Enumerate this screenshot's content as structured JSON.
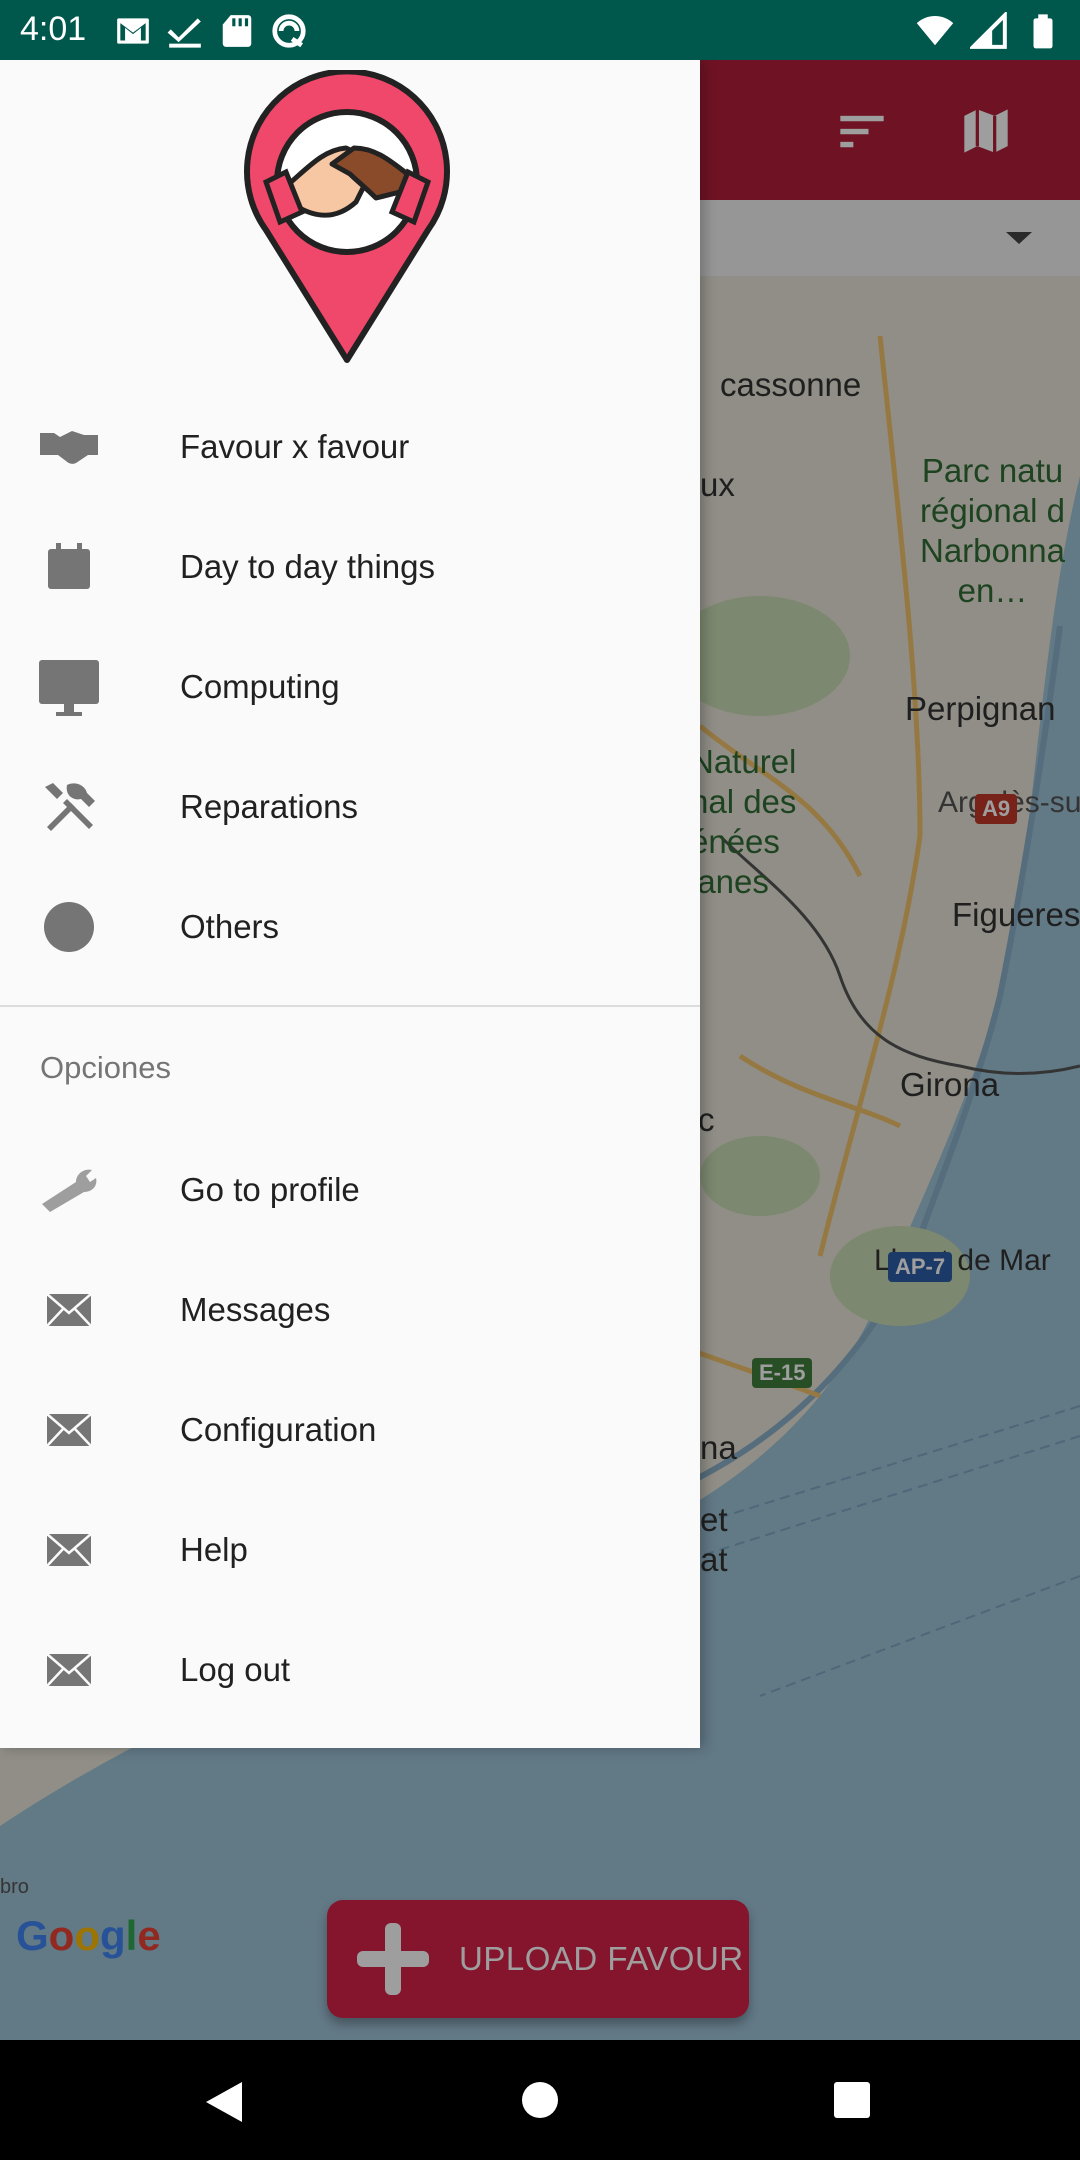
{
  "status_bar": {
    "time": "4:01",
    "left_icons": [
      "gmail-icon",
      "check-icon",
      "sd-card-icon",
      "sync-icon"
    ],
    "right_icons": [
      "wifi-icon",
      "signal-icon",
      "battery-icon"
    ]
  },
  "app_bar": {
    "color": "#B3203A",
    "icons": [
      "sort-icon",
      "map-icon"
    ]
  },
  "map": {
    "labels": [
      "cassonne",
      "ux",
      "Parc natu\nrégional d\nNarbonna\nen…",
      "Perpignan",
      "Naturel\nnal des\nénées\nlanes",
      "Argelès-su",
      "Figueres",
      "Girona",
      "c",
      "Lloret de Mar",
      "na",
      "et\nat",
      "bro"
    ],
    "road_badges": [
      "A9",
      "AP-7",
      "E-15"
    ]
  },
  "google_logo": "Google",
  "fab": {
    "label": "UPLOAD FAVOUR",
    "color": "#D6224A"
  },
  "drawer": {
    "categories": [
      {
        "label": "Favour x favour",
        "icon": "handshake-icon"
      },
      {
        "label": "Day to day things",
        "icon": "calendar-icon"
      },
      {
        "label": "Computing",
        "icon": "monitor-icon"
      },
      {
        "label": "Reparations",
        "icon": "tools-icon"
      },
      {
        "label": "Others",
        "icon": "circle-icon"
      }
    ],
    "section_title": "Opciones",
    "options": [
      {
        "label": "Go to profile",
        "icon": "wrench-icon"
      },
      {
        "label": "Messages",
        "icon": "mail-icon"
      },
      {
        "label": "Configuration",
        "icon": "mail-icon"
      },
      {
        "label": "Help",
        "icon": "mail-icon"
      },
      {
        "label": "Log out",
        "icon": "mail-icon"
      }
    ]
  },
  "nav_bar": {
    "buttons": [
      "back-icon",
      "home-icon",
      "recents-icon"
    ]
  }
}
